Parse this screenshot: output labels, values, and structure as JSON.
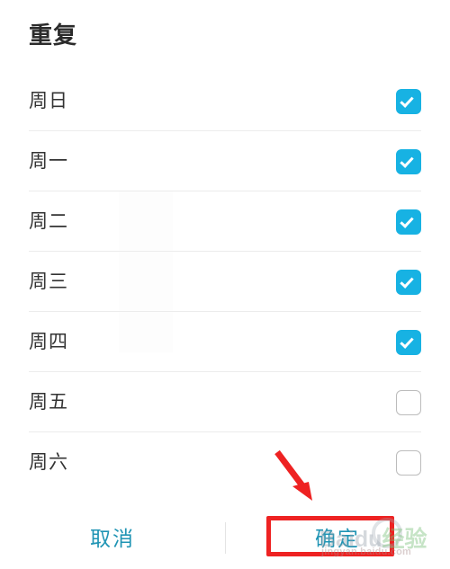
{
  "dialog": {
    "title": "重复"
  },
  "days": [
    {
      "label": "周日",
      "checked": true
    },
    {
      "label": "周一",
      "checked": true
    },
    {
      "label": "周二",
      "checked": true
    },
    {
      "label": "周三",
      "checked": true
    },
    {
      "label": "周四",
      "checked": true
    },
    {
      "label": "周五",
      "checked": false
    },
    {
      "label": "周六",
      "checked": false
    }
  ],
  "footer": {
    "cancel_label": "取消",
    "confirm_label": "确定"
  },
  "annotations": {
    "arrow": {
      "name": "red-arrow",
      "color": "#ee2222",
      "points_to": "confirm-button"
    },
    "highlight_box": {
      "name": "red-highlight-box",
      "color": "#ee2222",
      "around": "confirm-button"
    }
  },
  "watermark": {
    "brand": "Baidu",
    "brand_cn": "经验",
    "url": "jingyan.baidu.com"
  },
  "colors": {
    "checkbox_on": "#17b2e3",
    "checkbox_off_border": "#bcbcbc",
    "button_text": "#1f94b4",
    "divider": "#ececec",
    "title_text": "#2b2b2b",
    "label_text": "#333333",
    "annotation_red": "#ee2222"
  }
}
